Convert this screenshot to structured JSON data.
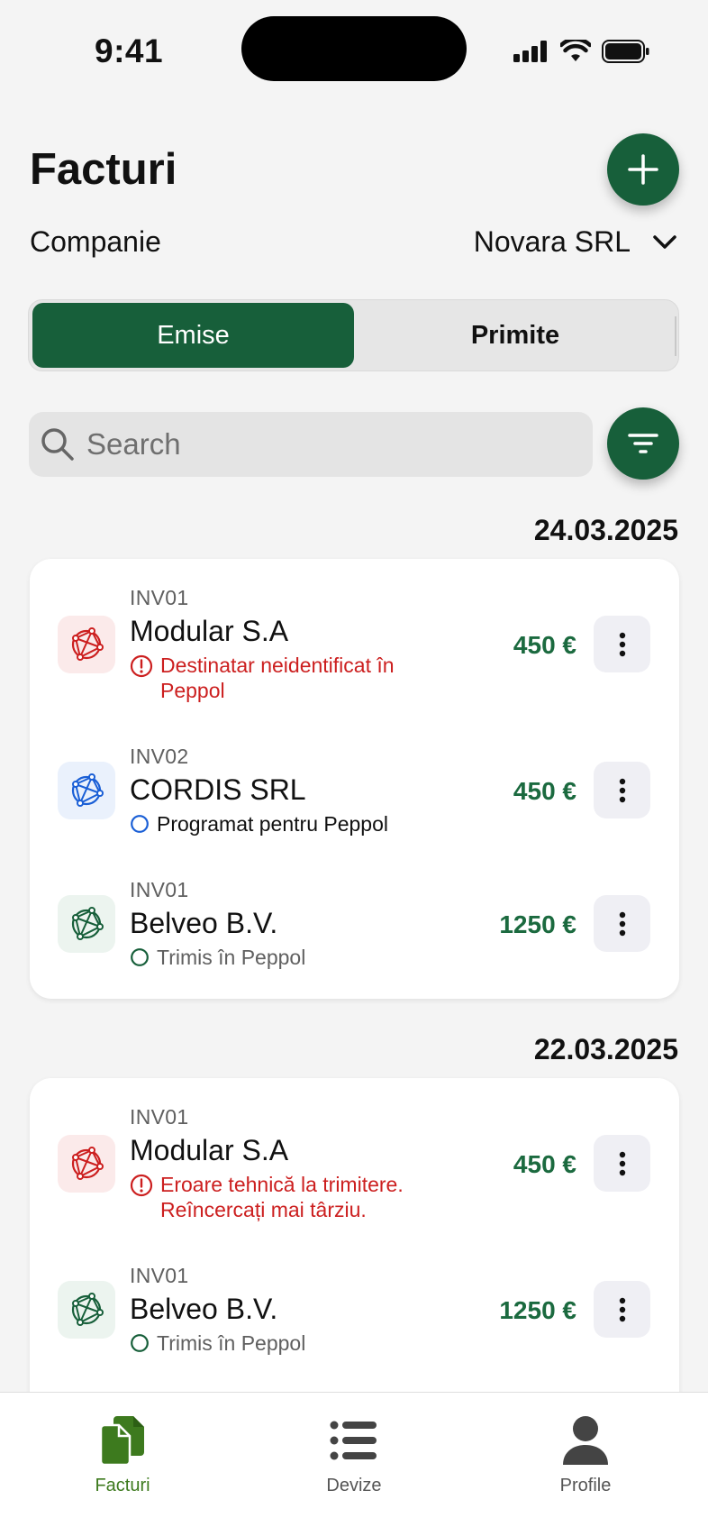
{
  "status_bar": {
    "time": "9:41"
  },
  "header": {
    "title": "Facturi",
    "add_icon": "plus-icon"
  },
  "company": {
    "label": "Companie",
    "value": "Novara SRL"
  },
  "segments": {
    "active": "Emise",
    "inactive": "Primite"
  },
  "search": {
    "placeholder": "Search"
  },
  "groups": [
    {
      "date": "24.03.2025",
      "items": [
        {
          "invoice": "INV01",
          "name": "Modular S.A",
          "status": "Destinatar neidentificat în Peppol",
          "status_type": "error",
          "amount": "450 €"
        },
        {
          "invoice": "INV02",
          "name": "CORDIS SRL",
          "status": "Programat pentru Peppol",
          "status_type": "scheduled",
          "amount": "450 €"
        },
        {
          "invoice": "INV01",
          "name": "Belveo B.V.",
          "status": "Trimis în Peppol",
          "status_type": "sent",
          "amount": "1250 €"
        }
      ]
    },
    {
      "date": "22.03.2025",
      "items": [
        {
          "invoice": "INV01",
          "name": "Modular S.A",
          "status": "Eroare tehnică la trimitere. Reîncercați mai târziu.",
          "status_type": "error",
          "amount": "450 €"
        },
        {
          "invoice": "INV01",
          "name": "Belveo B.V.",
          "status": "Trimis în Peppol",
          "status_type": "sent",
          "amount": "1250 €"
        }
      ]
    }
  ],
  "tabbar": {
    "items": [
      {
        "label": "Facturi",
        "icon": "documents-icon",
        "active": true
      },
      {
        "label": "Devize",
        "icon": "list-icon",
        "active": false
      },
      {
        "label": "Profile",
        "icon": "person-icon",
        "active": false
      }
    ]
  },
  "colors": {
    "brand": "#175f3a",
    "amount": "#1b6a3f",
    "error": "#cc1f1f",
    "scheduled": "#1a5fd6",
    "sent": "#175f3a"
  }
}
